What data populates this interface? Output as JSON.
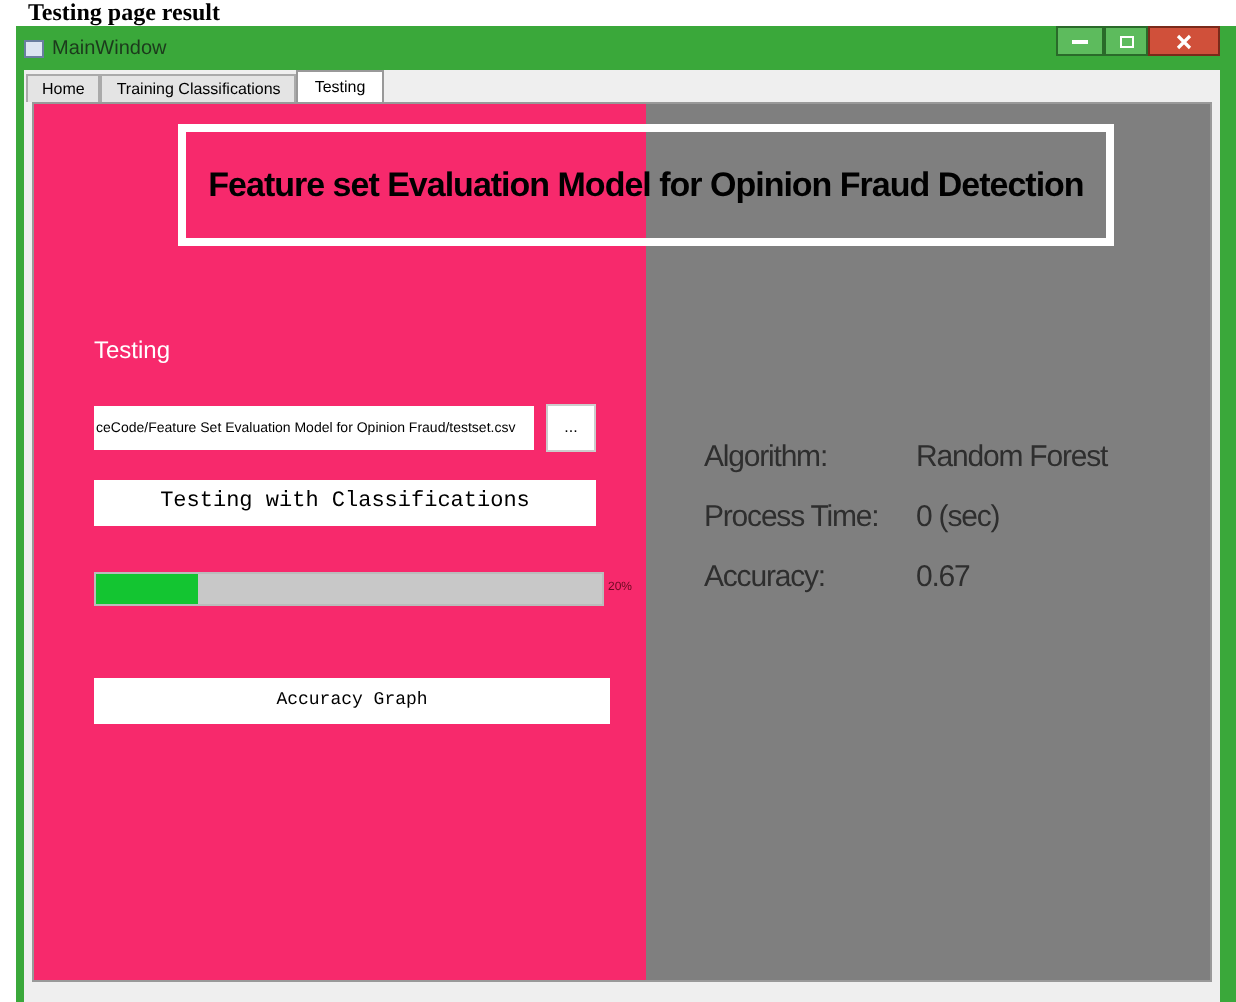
{
  "caption": "Testing page result",
  "window": {
    "title": "MainWindow"
  },
  "tabs": [
    {
      "label": "Home",
      "selected": false
    },
    {
      "label": "Training Classifications",
      "selected": false
    },
    {
      "label": "Testing",
      "selected": true
    }
  ],
  "banner": "Feature set Evaluation Model for Opinion Fraud Detection",
  "testing": {
    "heading": "Testing",
    "path": "ceCode/Feature Set Evaluation Model for Opinion Fraud/testset.csv",
    "browse_button": "...",
    "run_button": "Testing with Classifications",
    "progress": {
      "level": 0.2,
      "reading": "20%"
    },
    "graph_button": "Accuracy Graph"
  },
  "results": [
    {
      "label": "Algorithm:",
      "value": "Random Forest"
    },
    {
      "label": "Process Time:",
      "value": "0 (sec)"
    },
    {
      "label": "Accuracy:",
      "value": "0.67"
    }
  ]
}
